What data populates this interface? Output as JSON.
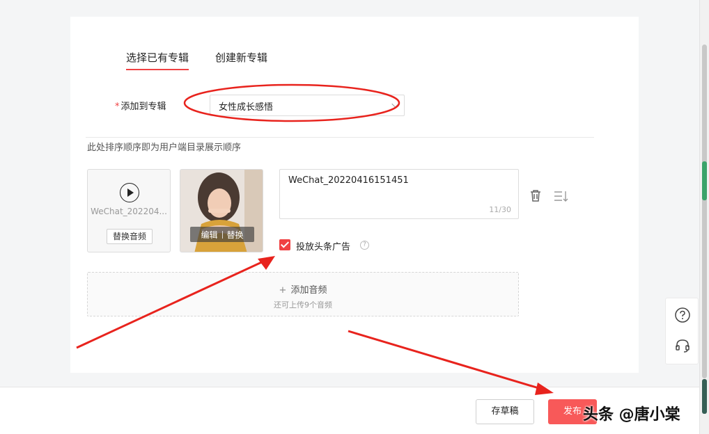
{
  "tabs": [
    {
      "label": "选择已有专辑"
    },
    {
      "label": "创建新专辑"
    }
  ],
  "album_field": {
    "label": "添加到专辑",
    "required_mark": "*",
    "selected_value": "女性成长感悟"
  },
  "hint_text": "此处排序顺序即为用户端目录展示顺序",
  "audio": {
    "name": "WeChat_202204...",
    "replace_label": "替换音频",
    "cover_edit_label": "编辑",
    "cover_replace_label": "替换",
    "title_value": "WeChat_20220416151451",
    "char_count": "11/30",
    "ad_label": "投放头条广告",
    "ad_checked": true
  },
  "add_audio": {
    "label": "添加音频",
    "sub_label": "还可上传9个音频"
  },
  "footer": {
    "draft_label": "存草稿",
    "publish_label": "发布"
  },
  "side_tools": [
    "question-icon",
    "headset-icon"
  ],
  "watermark": "头条 @唐小棠",
  "colors": {
    "accent": "#f04142",
    "publish": "#f85959",
    "annotation": "#e8231d"
  }
}
